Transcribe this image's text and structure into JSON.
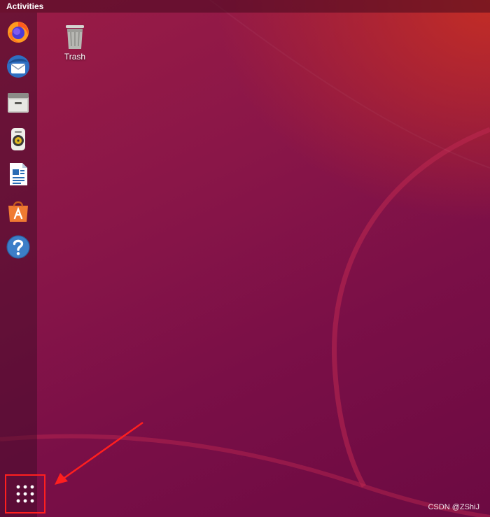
{
  "topbar": {
    "activities_label": "Activities"
  },
  "dock": {
    "items": [
      {
        "icon": "firefox-icon"
      },
      {
        "icon": "thunderbird-icon"
      },
      {
        "icon": "files-icon"
      },
      {
        "icon": "rhythmbox-icon"
      },
      {
        "icon": "libreoffice-writer-icon"
      },
      {
        "icon": "software-center-icon"
      },
      {
        "icon": "help-icon"
      }
    ],
    "show_apps_icon": "show-applications-grid-icon"
  },
  "desktop": {
    "icons": [
      {
        "label": "Trash",
        "icon": "trash-icon"
      }
    ]
  },
  "watermark": {
    "text": "CSDN @ZShiJ"
  },
  "colors": {
    "wallpaper_top_right": "#c32d25",
    "wallpaper_main": "#7a0f47",
    "highlight_box": "#ff1f1f",
    "arrow": "#ff1f1f"
  }
}
